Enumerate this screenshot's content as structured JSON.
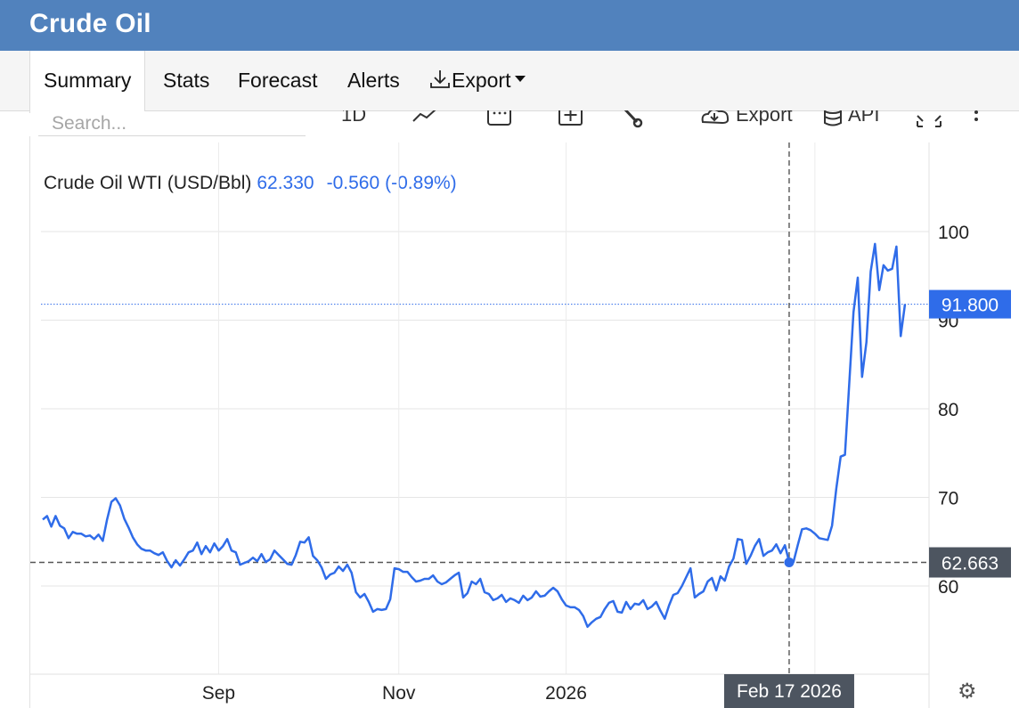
{
  "header": {
    "title": "Crude Oil"
  },
  "tabs": [
    {
      "label": "Summary",
      "active": true
    },
    {
      "label": "Stats"
    },
    {
      "label": "Forecast"
    },
    {
      "label": "Alerts"
    },
    {
      "label": "Export",
      "icon": "download-icon",
      "dropdown": true
    }
  ],
  "search": {
    "placeholder": "Search..."
  },
  "toolbar": {
    "timeframe_label": "1D",
    "export_label": "Export",
    "api_label": "API",
    "icons": [
      "line-chart-icon",
      "calendar-icon",
      "add-compare-icon",
      "wrench-icon",
      "cloud-download-icon",
      "database-icon",
      "fullscreen-icon",
      "more-icon"
    ]
  },
  "legend": {
    "name": "Crude Oil WTI (USD/Bbl)",
    "price": "62.330",
    "change": "-0.560",
    "change_pct": "(-0.89%)"
  },
  "colors": {
    "header_bg": "#5182bd",
    "line": "#2f6ce9",
    "last_price_bg": "#2f6ce9",
    "crosshair_label_bg": "#4d5560"
  },
  "chart_data": {
    "type": "line",
    "x_tick_labels": [
      "Sep",
      "Nov",
      "2026"
    ],
    "y_tick_labels": [
      "60",
      "70",
      "80",
      "90",
      "100"
    ],
    "ylim": [
      50,
      110
    ],
    "grid": true,
    "last_price_label": "91.800",
    "crosshair": {
      "date": "Feb 17 2026",
      "value": "62.663"
    },
    "series": [
      {
        "values": [
          67.5,
          67.9,
          66.7,
          67.9,
          66.8,
          66.5,
          65.4,
          66.1,
          65.9,
          65.9,
          65.6,
          65.7,
          65.3,
          65.8,
          65.1,
          67.5,
          69.5,
          69.9,
          69.1,
          67.6,
          66.6,
          65.5,
          64.7,
          64.2,
          64.0,
          64.0,
          63.7,
          63.5,
          63.8,
          62.8,
          62.1,
          62.9,
          62.3,
          63.0,
          63.8,
          64.0,
          64.9,
          63.6,
          64.5,
          63.8,
          64.8,
          64.0,
          64.5,
          65.3,
          64.0,
          63.8,
          62.4,
          62.6,
          62.8,
          63.2,
          62.8,
          63.6,
          62.7,
          63.0,
          64.0,
          63.5,
          63.0,
          62.5,
          62.4,
          63.5,
          65.0,
          64.9,
          65.5,
          63.4,
          62.9,
          62.1,
          60.8,
          61.3,
          61.5,
          62.2,
          61.7,
          62.4,
          61.5,
          59.3,
          58.7,
          59.1,
          58.2,
          57.1,
          57.4,
          57.3,
          57.4,
          58.5,
          62.0,
          61.9,
          61.6,
          61.6,
          61.0,
          60.5,
          60.6,
          60.8,
          60.8,
          61.2,
          60.5,
          60.2,
          60.4,
          60.8,
          61.2,
          61.5,
          58.7,
          59.2,
          60.5,
          60.2,
          60.8,
          59.3,
          59.1,
          58.4,
          58.6,
          59.0,
          58.2,
          58.6,
          58.4,
          58.1,
          58.9,
          58.4,
          58.7,
          59.4,
          58.8,
          58.9,
          59.4,
          59.8,
          59.4,
          58.5,
          57.8,
          57.6,
          57.6,
          57.3,
          56.6,
          55.4,
          55.9,
          56.3,
          56.5,
          57.4,
          58.1,
          58.3,
          57.1,
          57.0,
          58.2,
          57.4,
          58.0,
          57.9,
          58.4,
          57.4,
          57.7,
          58.2,
          57.2,
          56.3,
          57.8,
          59.0,
          59.2,
          60.0,
          61.0,
          62.0,
          58.7,
          59.1,
          59.4,
          60.5,
          60.9,
          59.5,
          61.1,
          60.6,
          62.2,
          63.1,
          65.3,
          65.2,
          62.5,
          63.4,
          64.5,
          65.3,
          63.4,
          63.8,
          64.0,
          64.7,
          63.7,
          64.6,
          62.7,
          62.7,
          64.6,
          66.4,
          66.5,
          66.3,
          65.9,
          65.4,
          65.3,
          65.2,
          66.8,
          71.0,
          74.6,
          74.8,
          82.8,
          90.9,
          94.8,
          83.6,
          87.5,
          95.5,
          98.6,
          93.4,
          96.2,
          95.6,
          95.8,
          98.3,
          88.2,
          91.8
        ]
      }
    ]
  }
}
